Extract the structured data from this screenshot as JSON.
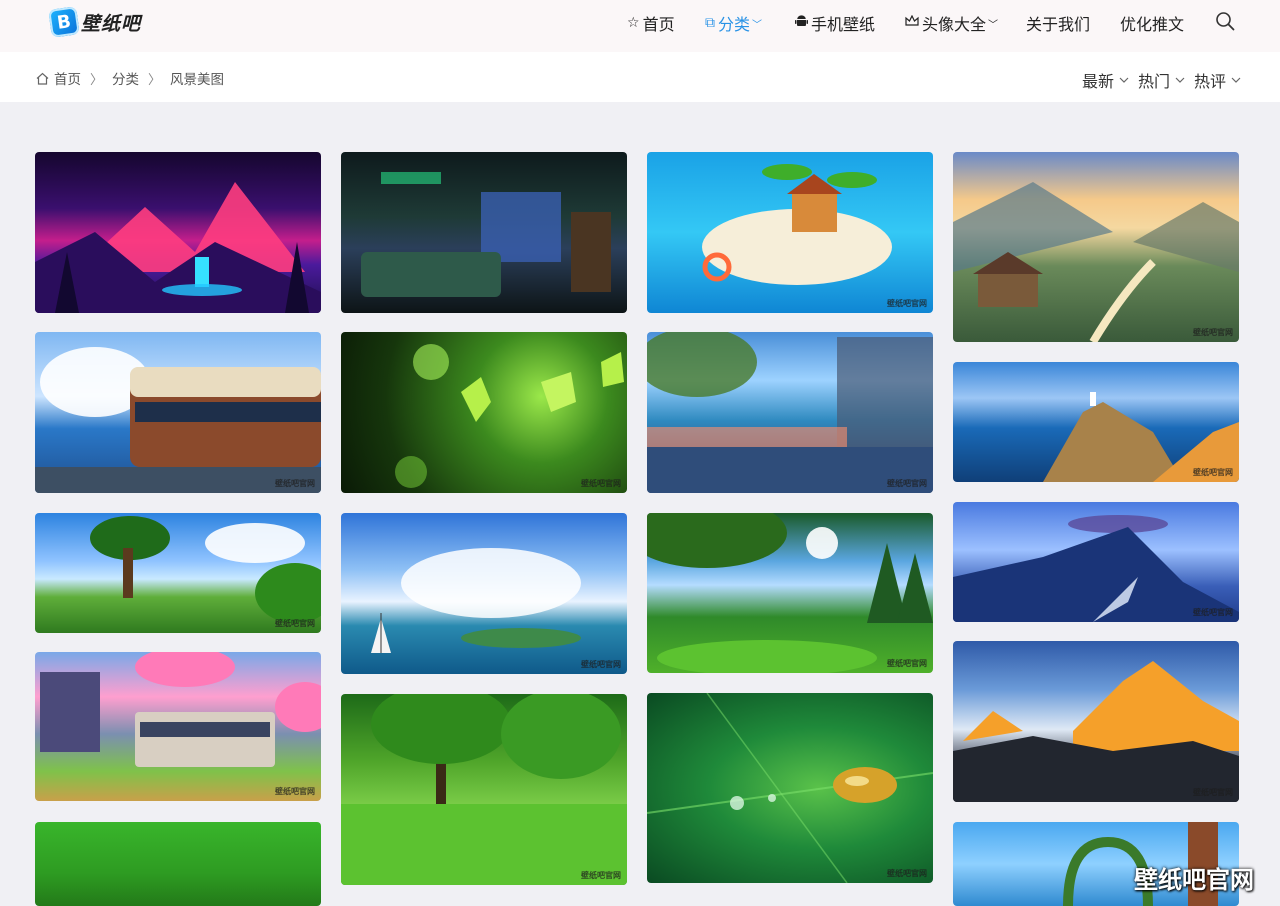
{
  "site": {
    "logo_letter": "B",
    "logo_text": "壁纸吧"
  },
  "nav": {
    "home": "首页",
    "category": "分类",
    "mobile": "手机壁纸",
    "avatar": "头像大全",
    "about": "关于我们",
    "seo": "优化推文"
  },
  "breadcrumb": {
    "home": "首页",
    "category": "分类",
    "current": "风景美图"
  },
  "sort": {
    "latest": "最新",
    "hot": "热门",
    "rating": "热评"
  },
  "watermark": "壁纸吧官网",
  "site_watermark": "壁纸吧官网",
  "colors": {
    "accent": "#2a93e6",
    "header_bg": "#fbf7f8",
    "page_bg": "#f0f0f4"
  },
  "wallpapers": [
    "neon-mountain-waterfall",
    "space-station-bedroom",
    "cartoon-island-palm-trees",
    "mountain-valley-village-sunrise",
    "retro-train-on-sea",
    "green-leaves-bokeh",
    "train-window-seaside-town",
    "cliff-lighthouse-coast",
    "anime-tree-meadow",
    "sailboat-sea-clouds",
    "sunlit-forest-meadow",
    "snowy-peak-lenticular-cloud",
    "train-cherry-blossom-street",
    "green-forest-park",
    "water-drops-on-leaf",
    "sunset-himalaya-peaks",
    "green-grass-field",
    "flower-arch-by-sea"
  ]
}
